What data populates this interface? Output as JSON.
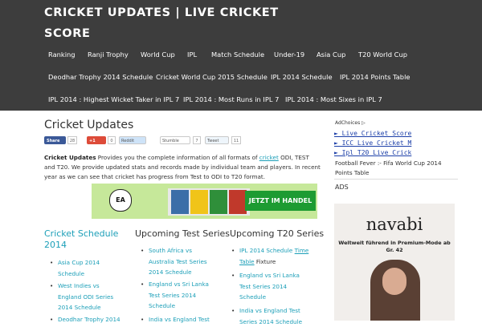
{
  "header": {
    "title": "CRICKET UPDATES | LIVE CRICKET SCORE",
    "nav": [
      "Ranking",
      "Ranji Trophy",
      "World Cup",
      "IPL",
      "Match Schedule",
      "Under-19",
      "Asia Cup",
      "T20 World Cup",
      "Deodhar Trophy 2014 Schedule",
      "Cricket World Cup 2015 Schedule",
      "IPL 2014 Schedule",
      "IPL 2014 Points Table",
      "IPL 2014 : Highest Wicket Taker in IPL 7",
      "IPL 2014 : Most Runs in IPL 7",
      "IPL 2014 : Most Sixes in IPL 7"
    ]
  },
  "main": {
    "title": "Cricket Updates",
    "share": {
      "facebook": "Share",
      "facebook_count": "28",
      "gplus": "+1",
      "gplus_count": "0",
      "reddit": "Reddit",
      "stumble": "Stumble",
      "stumble_count": "7",
      "tweet": "Tweet",
      "tweet_count": "11"
    },
    "intro": {
      "bold": "Cricket Updates",
      "text1": " Provides you the complete information of all formats of ",
      "link": "cricket",
      "text2": " ODI, TEST and T20. We provide updated stats and records made by individual team and players. In recent year as we can see that cricket has progress from Test to ODI to T20 format."
    },
    "banner": {
      "brand": "EA",
      "cta": "JETZT IM HANDEL"
    },
    "columns": [
      {
        "title": "Cricket Schedule 2014",
        "items": [
          "Asia Cup 2014 Schedule",
          "West Indies vs England ODI Series 2014 Schedule",
          "Deodhar Trophy 2014"
        ]
      },
      {
        "title": "Upcoming Test Series",
        "items": [
          "South Africa vs Australia Test Series 2014 Schedule",
          "England vs Sri Lanka Test Series 2014 Schedule",
          "India vs England Test"
        ]
      },
      {
        "title": "Upcoming T20 Series",
        "items": [
          "IPL 2014 Schedule",
          "England vs Sri Lanka Test Series 2014 Schedule",
          "India vs England Test Series 2014 Schedule"
        ],
        "item0_link": "Time Table",
        "item0_suffix": " Fixture"
      }
    ]
  },
  "sidebar": {
    "adchoices": "AdChoices ▷",
    "links": [
      "► Live Cricket Score",
      "► ICC Live Cricket M",
      "► Ipl T20 Live Crick"
    ],
    "fever": "Football Fever :- Fifa World Cup 2014 Points Table",
    "ads_label": "ADS",
    "ad": {
      "logo": "navabi",
      "tagline": "Weltweit führend in Premium-Mode ab Gr. 42"
    }
  },
  "colors": {
    "header_bg": "#3d3d3d",
    "link": "#1c9fb8",
    "sidebar_link": "#1c3fa8",
    "body_bg": "#ffffff"
  }
}
